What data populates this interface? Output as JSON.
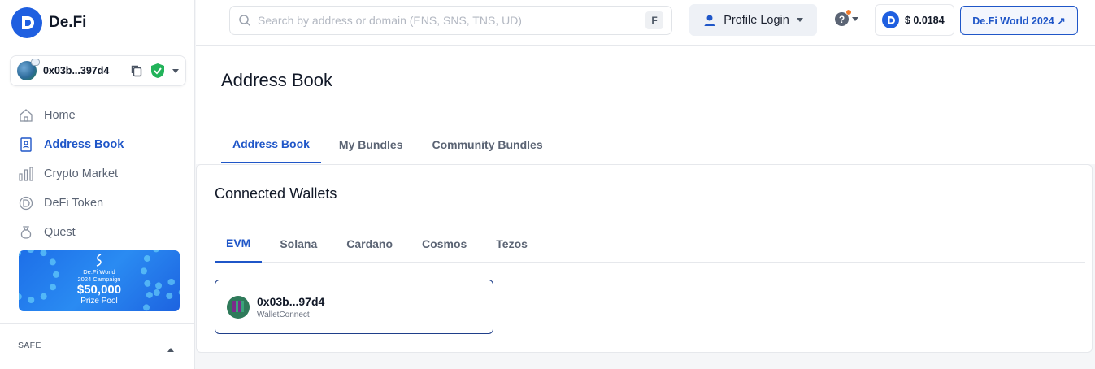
{
  "brand": {
    "name": "De.Fi",
    "accent": "#1f56c8"
  },
  "wallet": {
    "short_address": "0x03b...397d4"
  },
  "sidebar": {
    "items": [
      {
        "label": "Home",
        "icon": "home-icon"
      },
      {
        "label": "Address Book",
        "icon": "address-book-icon"
      },
      {
        "label": "Crypto Market",
        "icon": "bar-chart-icon"
      },
      {
        "label": "DeFi Token",
        "icon": "token-icon"
      },
      {
        "label": "Quest",
        "icon": "quest-bag-icon"
      }
    ],
    "promo": {
      "line1": "De.Fi World",
      "line2": "2024 Campaign",
      "amount": "$50,000",
      "pool": "Prize Pool"
    },
    "safe_label": "SAFE"
  },
  "header": {
    "search_placeholder": "Search by address or domain (ENS, SNS, TNS, UD)",
    "search_shortcut": "F",
    "profile_login": "Profile Login",
    "help_icon": "?",
    "price": "$ 0.0184",
    "world_button": "De.Fi World 2024 ↗"
  },
  "page": {
    "title": "Address Book",
    "tabs": [
      "Address Book",
      "My Bundles",
      "Community Bundles"
    ]
  },
  "connected": {
    "title": "Connected Wallets",
    "chains": [
      "EVM",
      "Solana",
      "Cardano",
      "Cosmos",
      "Tezos"
    ],
    "wallet": {
      "address": "0x03b...97d4",
      "provider": "WalletConnect"
    }
  }
}
